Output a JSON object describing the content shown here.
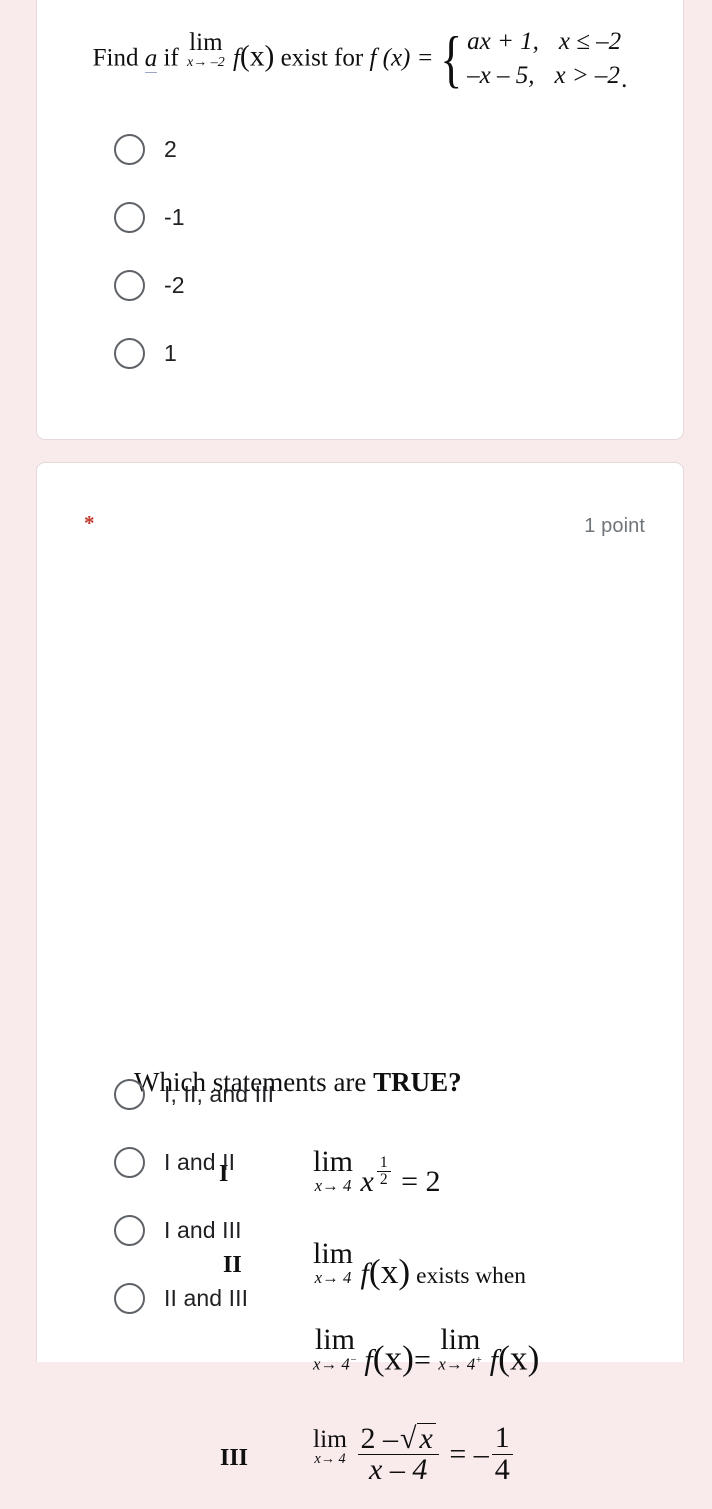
{
  "page": {
    "background_color": "#f9ebeb",
    "card_background": "#ffffff"
  },
  "questions": [
    {
      "id": "q1",
      "prompt_parts": {
        "find": "Find",
        "variable": "a",
        "if": "if",
        "lim_op": "lim",
        "lim_sub": "x→ –2",
        "func": "f",
        "arg": "(x)",
        "exist_for": "exist for",
        "fx_equals": "f (x) =",
        "piece_1_expr": "ax + 1,",
        "piece_1_cond": "x ≤ –2",
        "piece_2_expr": "–x – 5,",
        "piece_2_cond": "x > –2",
        "trailing": "."
      },
      "options": [
        {
          "label": "2",
          "selected": false
        },
        {
          "label": "-1",
          "selected": false
        },
        {
          "label": "-2",
          "selected": false
        },
        {
          "label": "1",
          "selected": false
        }
      ]
    },
    {
      "id": "q2",
      "required_marker": "*",
      "required_marker_color": "#c0392b",
      "points": "1 point",
      "points_color": "#70757a",
      "title_plain": "Which statements are ",
      "title_bold": "TRUE?",
      "statements": [
        {
          "roman": "I",
          "lim_op": "lim",
          "lim_sub": "x→ 4",
          "base": "x",
          "exp_num": "1",
          "exp_den": "2",
          "equals": "= 2"
        },
        {
          "roman": "II",
          "lim_op": "lim",
          "lim_sub": "x→ 4",
          "func": "f",
          "arg": "(x)",
          "tail": "exists when",
          "line2": {
            "lim_op_left": "lim",
            "lim_sub_left": "x→ 4",
            "lim_sub_left_sign": "−",
            "func_left": "f",
            "arg_left": "(x)",
            "equals": "=",
            "lim_op_right": "lim",
            "lim_sub_right": "x→ 4",
            "lim_sub_right_sign": "+",
            "func_right": "f",
            "arg_right": "(x)"
          }
        },
        {
          "roman": "III",
          "lim_op": "lim",
          "lim_sub": "x→ 4",
          "frac_num_prefix": "2 –",
          "frac_num_sqrt": "x",
          "frac_den": "x – 4",
          "equals": "=",
          "minus": "–",
          "result_num": "1",
          "result_den": "4"
        }
      ],
      "options": [
        {
          "label": "I, II, and III",
          "selected": false
        },
        {
          "label": "I and II",
          "selected": false
        },
        {
          "label": "I and III",
          "selected": false
        },
        {
          "label": "II and III",
          "selected": false
        }
      ]
    }
  ]
}
